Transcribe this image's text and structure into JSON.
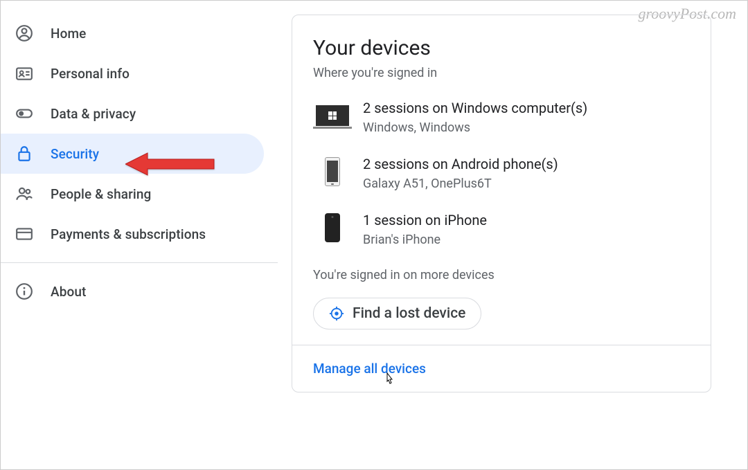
{
  "watermark": "groovyPost.com",
  "sidebar": {
    "items": [
      {
        "label": "Home"
      },
      {
        "label": "Personal info"
      },
      {
        "label": "Data & privacy"
      },
      {
        "label": "Security"
      },
      {
        "label": "People & sharing"
      },
      {
        "label": "Payments & subscriptions"
      },
      {
        "label": "About"
      }
    ]
  },
  "card": {
    "title": "Your devices",
    "subtitle": "Where you're signed in",
    "devices": [
      {
        "title": "2 sessions on Windows computer(s)",
        "detail": "Windows, Windows"
      },
      {
        "title": "2 sessions on Android phone(s)",
        "detail": "Galaxy A51, OnePlus6T"
      },
      {
        "title": "1 session on iPhone",
        "detail": "Brian's iPhone"
      }
    ],
    "more": "You're signed in on more devices",
    "find_label": "Find a lost device",
    "manage_label": "Manage all devices"
  }
}
